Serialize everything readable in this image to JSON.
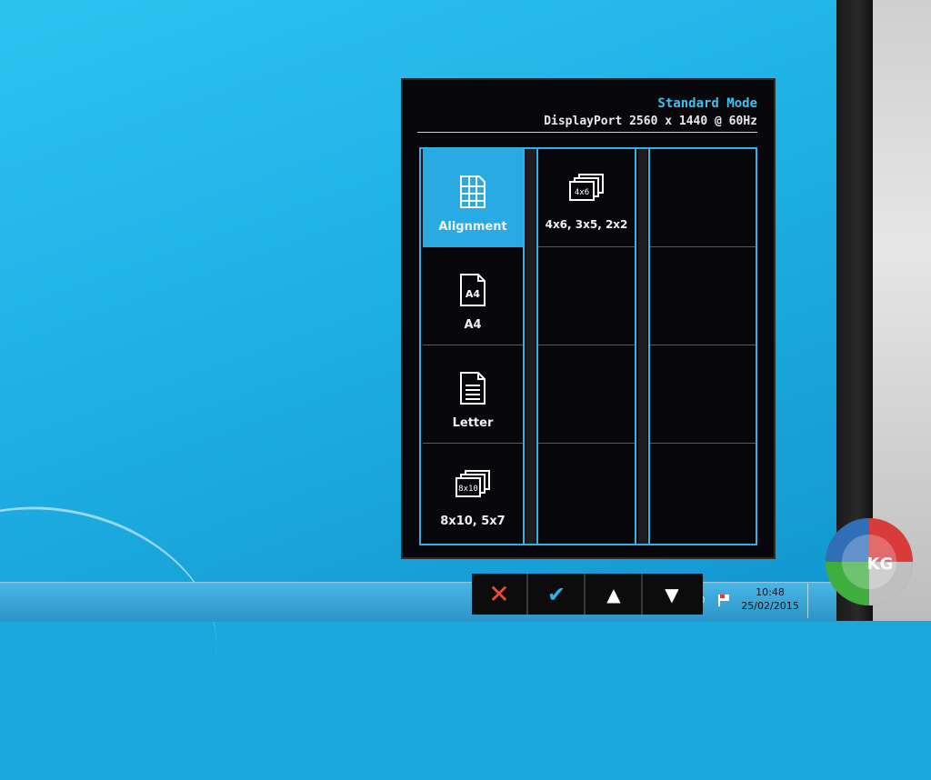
{
  "osd": {
    "mode": "Standard Mode",
    "signal": "DisplayPort  2560 x 1440 @ 60Hz",
    "menu": [
      {
        "label": "Alignment",
        "icon": "grid-icon",
        "selected": true
      },
      {
        "label": "A4",
        "icon": "a4-page-icon",
        "selected": false
      },
      {
        "label": "Letter",
        "icon": "letter-page-icon",
        "selected": false
      },
      {
        "label": "8x10, 5x7",
        "icon": "photo-8x10-icon",
        "selected": false
      }
    ],
    "submenu": [
      {
        "label": "4x6, 3x5, 2x2",
        "icon": "photo-4x6-icon",
        "badge": "4x6"
      }
    ],
    "icon_badges": {
      "a4": "A4",
      "photo": "8x10"
    }
  },
  "keys": {
    "close": "✕",
    "confirm": "✔",
    "up": "▲",
    "down": "▼"
  },
  "taskbar": {
    "time": "10:48",
    "date": "25/02/2015"
  },
  "logo": {
    "text": "KG"
  },
  "colors": {
    "accent": "#2fb3e6",
    "close": "#f04a3a",
    "osd_bg": "#07070c"
  }
}
